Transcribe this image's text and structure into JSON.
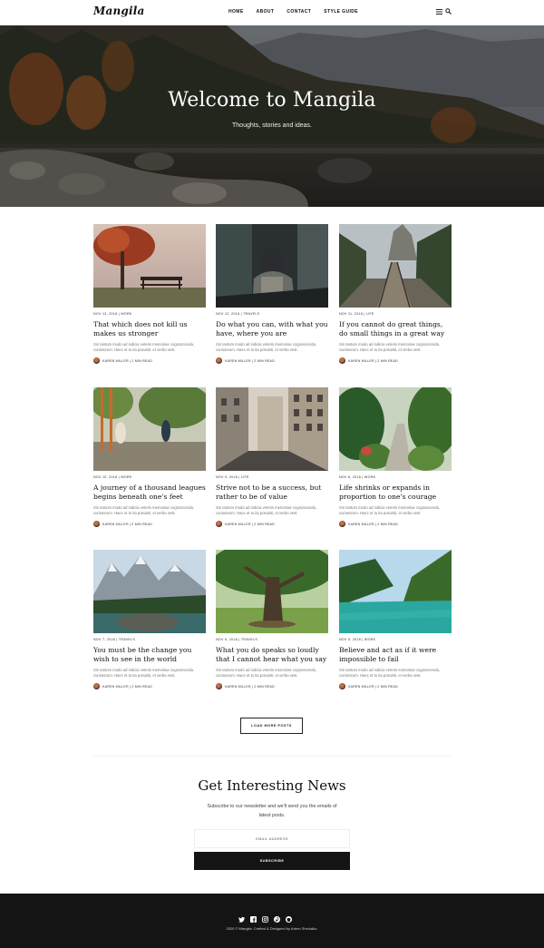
{
  "header": {
    "logo": "Mangila",
    "nav": [
      "HOME",
      "ABOUT",
      "CONTACT",
      "STYLE GUIDE"
    ],
    "icons": [
      "menu-icon",
      "search-icon"
    ]
  },
  "hero": {
    "title": "Welcome to Mangila",
    "subtitle": "Thoughts, stories and ideas."
  },
  "posts": [
    {
      "meta": "NOV 13, 2018 | WORK",
      "title": "That which does not kill us makes us stronger",
      "excerpt": "Sin tantum modo ad indicia veteris memoriae cognoscenda, curiosorum. Haec et tu ita posuisti, et verba vest.",
      "author": "KAREN MILLER | 2 MIN READ"
    },
    {
      "meta": "NOV 12, 2018 | TRAVELS",
      "title": "Do what you can, with what you have, where you are",
      "excerpt": "Sin tantum modo ad indicia veteris memoriae cognoscenda, curiosorum. Haec et tu ita posuisti, et verba vest.",
      "author": "KAREN MILLER | 2 MIN READ"
    },
    {
      "meta": "NOV 11, 2018 | LIFE",
      "title": "If you cannot do great things, do small things in a great way",
      "excerpt": "Sin tantum modo ad indicia veteris memoriae cognoscenda, curiosorum. Haec et tu ita posuisti, et verba vest.",
      "author": "KAREN MILLER | 2 MIN READ"
    },
    {
      "meta": "NOV 10, 2018 | WORK",
      "title": "A journey of a thousand leagues begins beneath one's feet",
      "excerpt": "Sin tantum modo ad indicia veteris memoriae cognoscenda, curiosorum. Haec et tu ita posuisti, et verba vest.",
      "author": "KAREN MILLER | 2 MIN READ"
    },
    {
      "meta": "NOV 9, 2018 | LIFE",
      "title": "Strive not to be a success, but rather to be of value",
      "excerpt": "Sin tantum modo ad indicia veteris memoriae cognoscenda, curiosorum. Haec et tu ita posuisti, et verba vest.",
      "author": "KAREN MILLER | 2 MIN READ"
    },
    {
      "meta": "NOV 8, 2018 | WORK",
      "title": "Life shrinks or expands in proportion to one's courage",
      "excerpt": "Sin tantum modo ad indicia veteris memoriae cognoscenda, curiosorum. Haec et tu ita posuisti, et verba vest.",
      "author": "KAREN MILLER | 2 MIN READ"
    },
    {
      "meta": "NOV 7, 2018 | TRAVELS",
      "title": "You must be the change you wish to see in the world",
      "excerpt": "Sin tantum modo ad indicia veteris memoriae cognoscenda, curiosorum. Haec et tu ita posuisti, et verba vest.",
      "author": "KAREN MILLER | 2 MIN READ"
    },
    {
      "meta": "NOV 6, 2018 | TRAVELS",
      "title": "What you do speaks so loudly that I cannot hear what you say",
      "excerpt": "Sin tantum modo ad indicia veteris memoriae cognoscenda, curiosorum. Haec et tu ita posuisti, et verba vest.",
      "author": "KAREN MILLER | 2 MIN READ"
    },
    {
      "meta": "NOV 5, 2018 | WORK",
      "title": "Believe and act as if it were impossible to fail",
      "excerpt": "Sin tantum modo ad indicia veteris memoriae cognoscenda, curiosorum. Haec et tu ita posuisti, et verba vest.",
      "author": "KAREN MILLER | 2 MIN READ"
    }
  ],
  "load_more": "LOAD MORE POSTS",
  "newsletter": {
    "title": "Get Interesting News",
    "text": "Subscribe to our newsletter and we'll send you the emails of latest posts.",
    "email_placeholder": "EMAIL ADDRESS",
    "button": "SUBSCRIBE"
  },
  "footer": {
    "social_icons": [
      "twitter-icon",
      "facebook-icon",
      "instagram-icon",
      "pinterest-icon",
      "github-icon"
    ],
    "copyright": "2020 © Mangila. Crafted & Designed by Artem Sheludko."
  },
  "colors": {
    "dark": "#141414",
    "text": "#111111",
    "muted": "#777777"
  }
}
